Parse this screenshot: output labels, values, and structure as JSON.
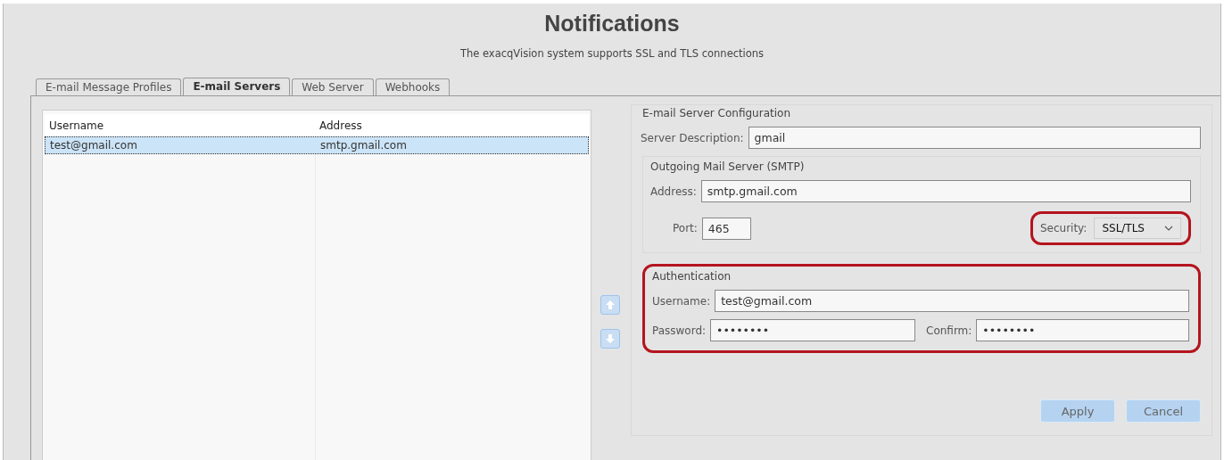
{
  "title": "Notifications",
  "subtitle": "The exacqVision system supports SSL and TLS connections",
  "tabs": [
    {
      "label": "E-mail Message Profiles",
      "selected": false
    },
    {
      "label": "E-mail Servers",
      "selected": true
    },
    {
      "label": "Web Server",
      "selected": false
    },
    {
      "label": "Webhooks",
      "selected": false
    }
  ],
  "server_list": {
    "columns": [
      "Username",
      "Address"
    ],
    "rows": [
      {
        "cells": [
          "test@gmail.com",
          "smtp.gmail.com"
        ],
        "selected": true
      }
    ]
  },
  "config": {
    "legend": "E-mail Server Configuration",
    "server_description": {
      "label": "Server Description:",
      "value": "gmail"
    },
    "smtp": {
      "legend": "Outgoing Mail Server (SMTP)",
      "address": {
        "label": "Address:",
        "value": "smtp.gmail.com"
      },
      "port": {
        "label": "Port:",
        "value": "465"
      },
      "security": {
        "label": "Security:",
        "value": "SSL/TLS",
        "highlighted": true
      }
    },
    "authentication": {
      "legend": "Authentication",
      "highlighted": true,
      "username": {
        "label": "Username:",
        "value": "test@gmail.com"
      },
      "password": {
        "label": "Password:",
        "value": "••••••••"
      },
      "confirm": {
        "label": "Confirm:",
        "value": "••••••••"
      }
    },
    "buttons": [
      "Apply",
      "Cancel"
    ]
  }
}
